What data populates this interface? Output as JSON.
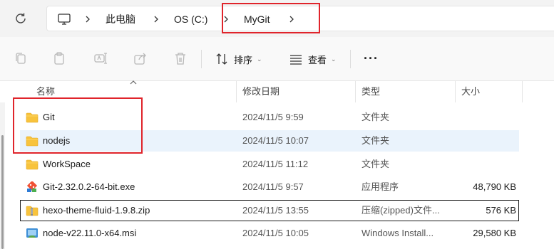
{
  "address_bar": {
    "breadcrumbs": [
      "此电脑",
      "OS (C:)",
      "MyGit"
    ]
  },
  "toolbar": {
    "sort_label": "排序",
    "view_label": "查看",
    "more_label": "···"
  },
  "columns": {
    "name": "名称",
    "modified": "修改日期",
    "type": "类型",
    "size": "大小"
  },
  "files": [
    {
      "name": "Git",
      "modified": "2024/11/5 9:59",
      "type": "文件夹",
      "size": "",
      "icon": "folder-icon"
    },
    {
      "name": "nodejs",
      "modified": "2024/11/5 10:07",
      "type": "文件夹",
      "size": "",
      "icon": "folder-icon"
    },
    {
      "name": "WorkSpace",
      "modified": "2024/11/5 11:12",
      "type": "文件夹",
      "size": "",
      "icon": "folder-icon"
    },
    {
      "name": "Git-2.32.0.2-64-bit.exe",
      "modified": "2024/11/5 9:57",
      "type": "应用程序",
      "size": "48,790 KB",
      "icon": "git-exe-icon"
    },
    {
      "name": "hexo-theme-fluid-1.9.8.zip",
      "modified": "2024/11/5 13:55",
      "type": "压缩(zipped)文件...",
      "size": "576 KB",
      "icon": "zip-icon"
    },
    {
      "name": "node-v22.11.0-x64.msi",
      "modified": "2024/11/5 10:05",
      "type": "Windows Install...",
      "size": "29,580 KB",
      "icon": "msi-icon"
    }
  ],
  "colors": {
    "highlight_box": "#e0242b",
    "selected_row": "#eaf3fc",
    "folder_yellow": "#f8c33c"
  }
}
